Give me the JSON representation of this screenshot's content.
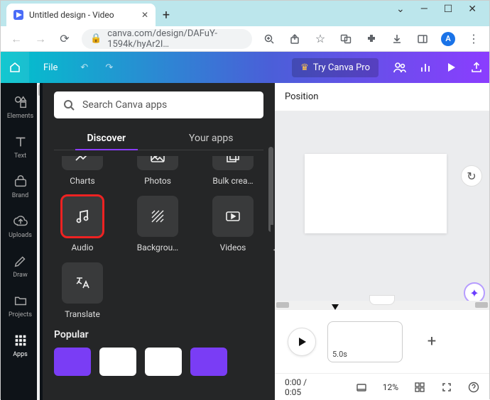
{
  "browser": {
    "tab_title": "Untitled design - Video",
    "url": "canva.com/design/DAFuY-1594k/hyAr2I…",
    "avatar_letter": "A"
  },
  "appbar": {
    "file": "File",
    "try_pro": "Try Canva Pro"
  },
  "iconbar": {
    "items": [
      {
        "label": "Elements"
      },
      {
        "label": "Text"
      },
      {
        "label": "Brand"
      },
      {
        "label": "Uploads"
      },
      {
        "label": "Draw"
      },
      {
        "label": "Projects"
      },
      {
        "label": "Apps"
      }
    ]
  },
  "panel": {
    "search_placeholder": "Search Canva apps",
    "tabs": {
      "discover": "Discover",
      "your_apps": "Your apps"
    },
    "row1": [
      {
        "label": "Charts"
      },
      {
        "label": "Photos"
      },
      {
        "label": "Bulk crea…"
      }
    ],
    "row2": [
      {
        "label": "Audio"
      },
      {
        "label": "Backgrou…"
      },
      {
        "label": "Videos"
      }
    ],
    "row3": [
      {
        "label": "Translate"
      }
    ],
    "popular_title": "Popular"
  },
  "canvas": {
    "position": "Position"
  },
  "timeline": {
    "clip_duration": "5.0s"
  },
  "status": {
    "time": "0:00 / 0:05",
    "zoom": "12%"
  }
}
